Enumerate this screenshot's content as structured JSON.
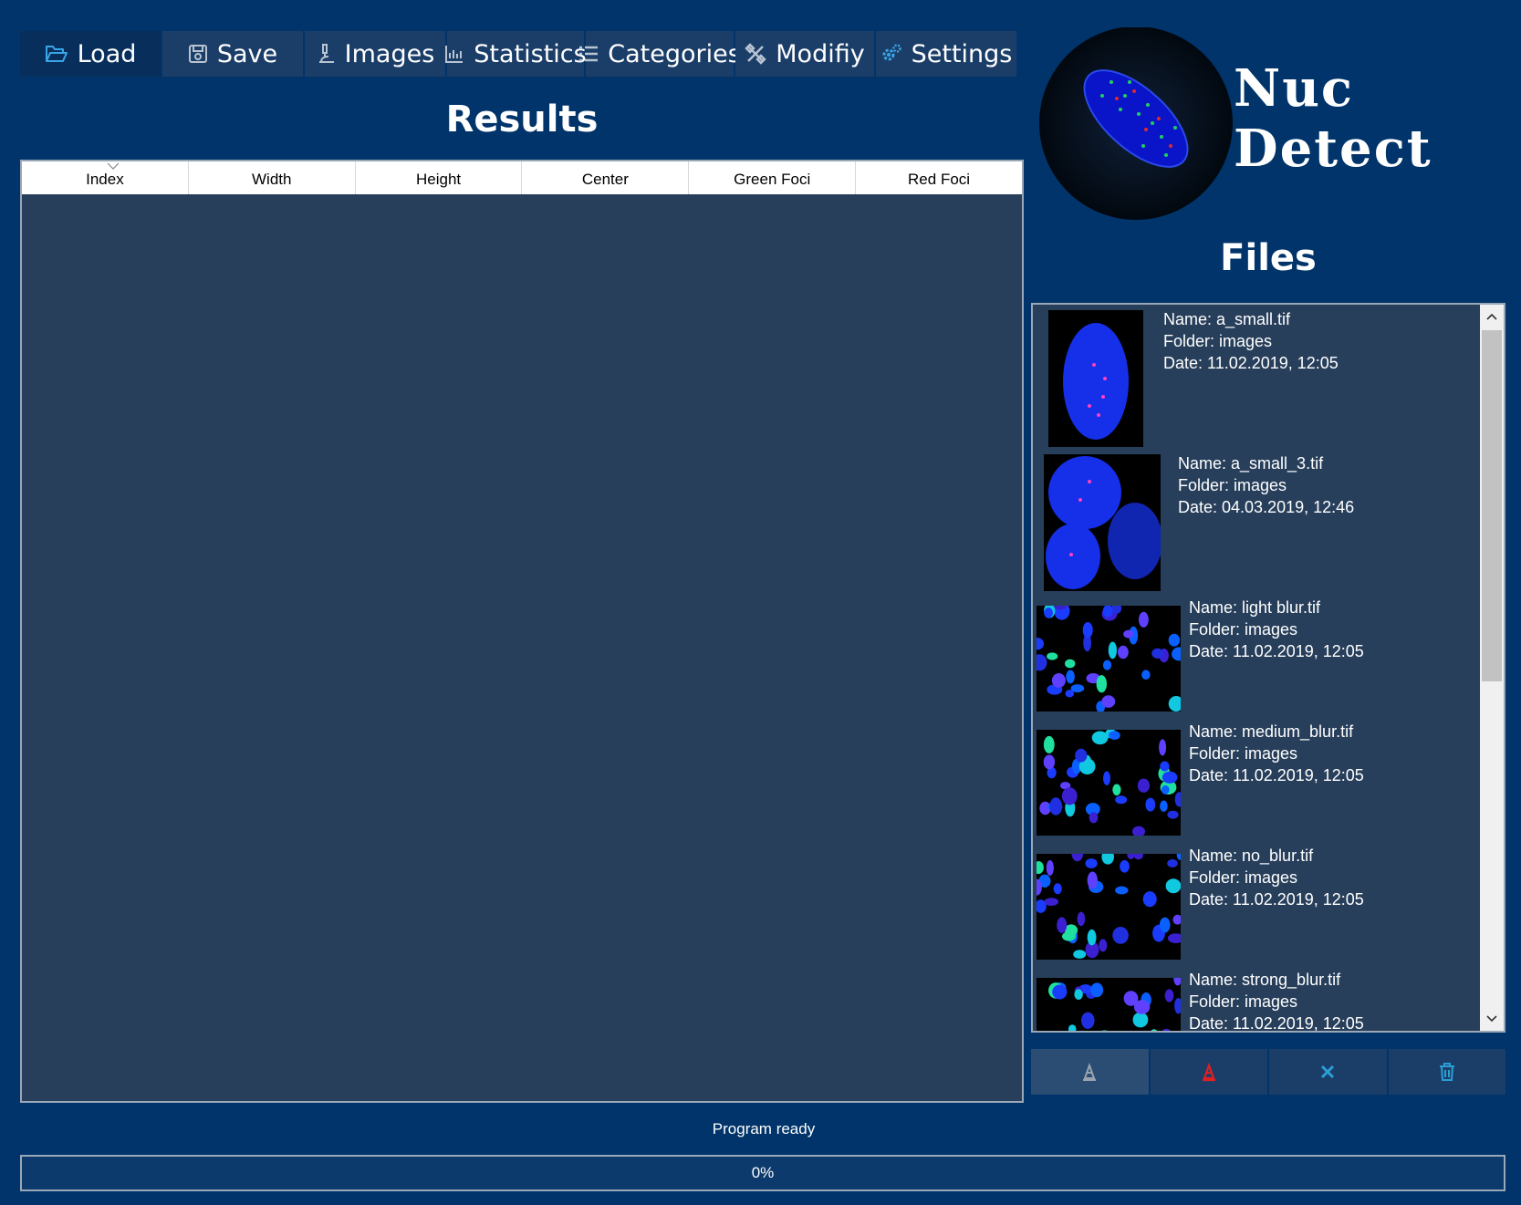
{
  "toolbar": {
    "load": "Load",
    "save": "Save",
    "images": "Images",
    "statistics": "Statistics",
    "categories": "Categories",
    "modify": "Modifiy",
    "settings": "Settings"
  },
  "results": {
    "title": "Results",
    "columns": [
      "Index",
      "Width",
      "Height",
      "Center",
      "Green Foci",
      "Red Foci"
    ]
  },
  "logo": {
    "line1": "Nuc",
    "line2": "Detect"
  },
  "files": {
    "title": "Files",
    "items": [
      {
        "name": "Name: a_small.tif",
        "folder": "Folder: images",
        "date": "Date: 11.02.2019, 12:05"
      },
      {
        "name": "Name: a_small_3.tif",
        "folder": "Folder: images",
        "date": "Date: 04.03.2019, 12:46"
      },
      {
        "name": "Name: light blur.tif",
        "folder": "Folder: images",
        "date": "Date: 11.02.2019, 12:05"
      },
      {
        "name": "Name: medium_blur.tif",
        "folder": "Folder: images",
        "date": "Date: 11.02.2019, 12:05"
      },
      {
        "name": "Name: no_blur.tif",
        "folder": "Folder: images",
        "date": "Date: 11.02.2019, 12:05"
      },
      {
        "name": "Name: strong_blur.tif",
        "folder": "Folder: images",
        "date": "Date: 11.02.2019, 12:05"
      }
    ],
    "actions": [
      "analyze-icon",
      "analyze-all-icon",
      "clear-icon",
      "delete-icon"
    ]
  },
  "status": {
    "message": "Program ready",
    "progress_label": "0%",
    "progress": 0
  },
  "colors": {
    "background": "#00346a",
    "button": "#1b3e69",
    "panel": "#273f5b",
    "accent": "#2a9fd6",
    "red": "#e02020"
  }
}
